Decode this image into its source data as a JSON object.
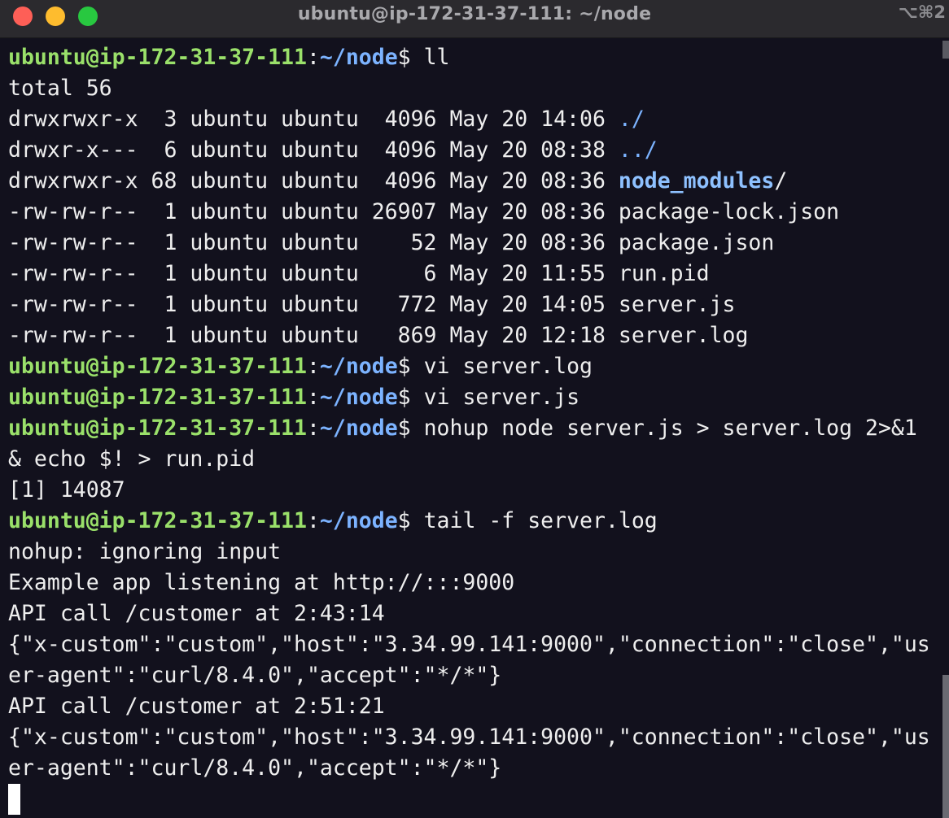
{
  "window": {
    "title": "ubuntu@ip-172-31-37-111: ~/node",
    "shortcut": "⌥⌘2"
  },
  "prompt": {
    "user_host": "ubuntu@ip-172-31-37-111",
    "colon": ":",
    "path": "~/node",
    "symbol": "$ "
  },
  "lines": [
    {
      "type": "prompt",
      "command": "ll"
    },
    {
      "type": "output",
      "text": "total 56"
    },
    {
      "type": "ls",
      "perm": "drwxrwxr-x  3 ubuntu ubuntu  4096 May 20 14:06 ",
      "name": "./",
      "style": "dir"
    },
    {
      "type": "ls",
      "perm": "drwxr-x---  6 ubuntu ubuntu  4096 May 20 08:38 ",
      "name": "../",
      "style": "dir"
    },
    {
      "type": "ls",
      "perm": "drwxrwxr-x 68 ubuntu ubuntu  4096 May 20 08:36 ",
      "name": "node_modules",
      "style": "dir-bold",
      "suffix": "/"
    },
    {
      "type": "ls",
      "perm": "-rw-rw-r--  1 ubuntu ubuntu 26907 May 20 08:36 ",
      "name": "package-lock.json",
      "style": "file"
    },
    {
      "type": "ls",
      "perm": "-rw-rw-r--  1 ubuntu ubuntu    52 May 20 08:36 ",
      "name": "package.json",
      "style": "file"
    },
    {
      "type": "ls",
      "perm": "-rw-rw-r--  1 ubuntu ubuntu     6 May 20 11:55 ",
      "name": "run.pid",
      "style": "file"
    },
    {
      "type": "ls",
      "perm": "-rw-rw-r--  1 ubuntu ubuntu   772 May 20 14:05 ",
      "name": "server.js",
      "style": "file"
    },
    {
      "type": "ls",
      "perm": "-rw-rw-r--  1 ubuntu ubuntu   869 May 20 12:18 ",
      "name": "server.log",
      "style": "file"
    },
    {
      "type": "prompt",
      "command": "vi server.log"
    },
    {
      "type": "prompt",
      "command": "vi server.js"
    },
    {
      "type": "prompt",
      "command": "nohup node server.js > server.log 2>&1"
    },
    {
      "type": "output",
      "text": "& echo $! > run.pid"
    },
    {
      "type": "output",
      "text": "[1] 14087"
    },
    {
      "type": "prompt",
      "command": "tail -f server.log"
    },
    {
      "type": "output",
      "text": "nohup: ignoring input"
    },
    {
      "type": "output",
      "text": "Example app listening at http://:::9000"
    },
    {
      "type": "output",
      "text": "API call /customer at 2:43:14"
    },
    {
      "type": "output",
      "text": "{\"x-custom\":\"custom\",\"host\":\"3.34.99.141:9000\",\"connection\":\"close\",\"us"
    },
    {
      "type": "output",
      "text": "er-agent\":\"curl/8.4.0\",\"accept\":\"*/*\"}"
    },
    {
      "type": "output",
      "text": "API call /customer at 2:51:21"
    },
    {
      "type": "output",
      "text": "{\"x-custom\":\"custom\",\"host\":\"3.34.99.141:9000\",\"connection\":\"close\",\"us"
    },
    {
      "type": "output",
      "text": "er-agent\":\"curl/8.4.0\",\"accept\":\"*/*\"}"
    },
    {
      "type": "cursor"
    }
  ],
  "colors": {
    "background": "#12111d",
    "prompt_user": "#9ae06a",
    "prompt_path": "#7cb3ff",
    "text": "#eeeeee"
  }
}
